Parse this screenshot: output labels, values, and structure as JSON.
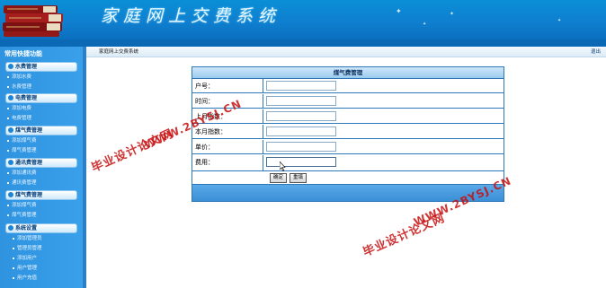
{
  "header": {
    "title": "家庭网上交费系统"
  },
  "sidebar": {
    "title": "常用快捷功能",
    "groups": [
      {
        "label": "水费管理",
        "items": [
          "添加水费",
          "水费管理"
        ]
      },
      {
        "label": "电费管理",
        "items": [
          "添加电费",
          "电费管理"
        ]
      },
      {
        "label": "煤气费管理",
        "items": [
          "添加煤气费",
          "煤气费管理"
        ]
      },
      {
        "label": "通讯费管理",
        "items": [
          "添加通讯费",
          "通讯费管理"
        ]
      },
      {
        "label": "煤气费管理",
        "items": [
          "添加煤气费",
          "煤气费管理"
        ]
      },
      {
        "label": "系统设置",
        "items": [
          "添加管理员",
          "管理员管理",
          "添加用户",
          "用户管理",
          "用户充值"
        ]
      }
    ]
  },
  "crumb": {
    "text": "家庭网上交费系统",
    "logout": "退出"
  },
  "form": {
    "title": "煤气费管理",
    "fields": [
      {
        "label": "户号：",
        "value": ""
      },
      {
        "label": "时间：",
        "value": ""
      },
      {
        "label": "上月指数：",
        "value": ""
      },
      {
        "label": "本月指数：",
        "value": ""
      },
      {
        "label": "单价：",
        "value": ""
      },
      {
        "label": "费用：",
        "value": ""
      }
    ],
    "submit": "确定",
    "reset": "重填"
  },
  "watermark": {
    "line1": "毕业设计论文网",
    "line2": "WWW.2BYSJ.CN"
  }
}
